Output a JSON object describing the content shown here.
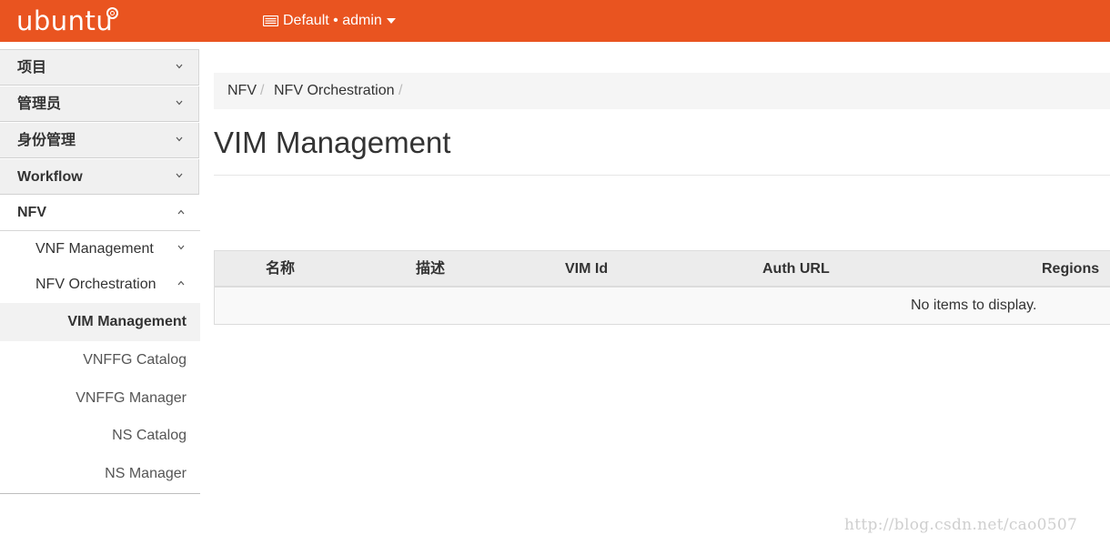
{
  "header": {
    "brand": "ubuntu",
    "project_switcher": "Default • admin"
  },
  "sidebar": {
    "dashboards": [
      {
        "label": "项目",
        "state": "collapsed"
      },
      {
        "label": "管理员",
        "state": "collapsed"
      },
      {
        "label": "身份管理",
        "state": "collapsed"
      },
      {
        "label": "Workflow",
        "state": "collapsed"
      }
    ],
    "nfv": {
      "label": "NFV",
      "state": "expanded"
    },
    "panels": [
      {
        "label": "VNF Management",
        "state": "collapsed"
      },
      {
        "label": "NFV Orchestration",
        "state": "expanded"
      }
    ],
    "items": [
      {
        "label": "VIM Management",
        "active": true
      },
      {
        "label": "VNFFG Catalog"
      },
      {
        "label": "VNFFG Manager"
      },
      {
        "label": "NS Catalog"
      },
      {
        "label": "NS Manager"
      }
    ]
  },
  "breadcrumb": {
    "items": [
      "NFV",
      "NFV Orchestration"
    ],
    "separator": "/"
  },
  "page": {
    "title": "VIM Management"
  },
  "table": {
    "columns": [
      "名称",
      "描述",
      "VIM Id",
      "Auth URL",
      "Regions"
    ],
    "empty_message": "No items to display."
  },
  "watermark": "http://blog.csdn.net/cao0507",
  "colors": {
    "brand_orange": "#e95420",
    "sidebar_bg": "#f0f0f0",
    "active_bg": "#f2f2f2"
  }
}
